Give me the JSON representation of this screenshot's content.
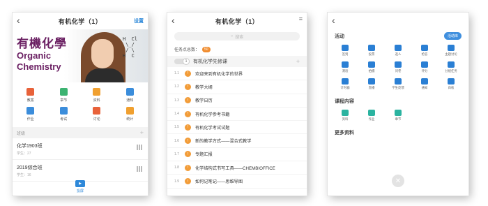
{
  "phone1": {
    "title": "有机化学（1）",
    "settings": "设置",
    "banner": {
      "cn": "有機化學",
      "en1": "Organic",
      "en2": "Chemistry"
    },
    "grid": [
      {
        "label": "教案",
        "icon": "lesson-plan-icon",
        "color": "#e8623a"
      },
      {
        "label": "章节",
        "icon": "chapter-icon",
        "color": "#3cb371"
      },
      {
        "label": "资料",
        "icon": "folder-icon",
        "color": "#f0a030"
      },
      {
        "label": "通知",
        "icon": "megaphone-icon",
        "color": "#3b8ddb"
      },
      {
        "label": "作业",
        "icon": "homework-icon",
        "color": "#3b8ddb"
      },
      {
        "label": "考试",
        "icon": "exam-icon",
        "color": "#3b8ddb"
      },
      {
        "label": "讨论",
        "icon": "discussion-icon",
        "color": "#e8623a"
      },
      {
        "label": "统计",
        "icon": "pie-chart-icon",
        "color": "#f0a030"
      }
    ],
    "classes_label": "班级",
    "classes": [
      {
        "name": "化学1903班",
        "students": "学生：27"
      },
      {
        "name": "2019综合班",
        "students": "学生：16"
      }
    ],
    "bottom_label": "投屏"
  },
  "phone2": {
    "title": "有机化学（1）",
    "search_placeholder": "搜索",
    "task_points_label": "任务点总数：",
    "task_points_value": "50",
    "chapter": {
      "num": "1",
      "title": "有机化学先修课"
    },
    "lessons": [
      {
        "num": "1.1",
        "title": "欢迎来到有机化学的世界"
      },
      {
        "num": "1.2",
        "title": "教学大纲"
      },
      {
        "num": "1.3",
        "title": "教学日历"
      },
      {
        "num": "1.4",
        "title": "有机化学参考书籍"
      },
      {
        "num": "1.5",
        "title": "有机化学考试试题"
      },
      {
        "num": "1.6",
        "title": "新的教学方式——混合式教学"
      },
      {
        "num": "1.7",
        "title": "专题汇报"
      },
      {
        "num": "1.8",
        "title": "化学结构式书写工具——CHEMBIOFFICE"
      },
      {
        "num": "1.9",
        "title": "如何记笔记——思维导图"
      }
    ]
  },
  "phone3": {
    "activities_label": "活动",
    "activity_library": "活动库",
    "activities": [
      {
        "label": "签到",
        "icon": "checkin-icon"
      },
      {
        "label": "投票",
        "icon": "vote-icon"
      },
      {
        "label": "选人",
        "icon": "pick-person-icon"
      },
      {
        "label": "抢答",
        "icon": "quick-answer-icon"
      },
      {
        "label": "主题讨论",
        "icon": "topic-discussion-icon"
      },
      {
        "label": "测验",
        "icon": "quiz-icon"
      },
      {
        "label": "拍摄",
        "icon": "camera-icon"
      },
      {
        "label": "问卷",
        "icon": "questionnaire-icon"
      },
      {
        "label": "评分",
        "icon": "rating-icon"
      },
      {
        "label": "分组任务",
        "icon": "group-task-icon"
      },
      {
        "label": "计时器",
        "icon": "timer-icon"
      },
      {
        "label": "直播",
        "icon": "live-icon"
      },
      {
        "label": "学生反馈",
        "icon": "feedback-icon"
      },
      {
        "label": "通知",
        "icon": "notice-icon"
      },
      {
        "label": "白板",
        "icon": "whiteboard-icon"
      }
    ],
    "course_content_label": "课程内容",
    "course_content": [
      {
        "label": "资料",
        "icon": "materials-icon"
      },
      {
        "label": "作业",
        "icon": "homework-icon"
      },
      {
        "label": "章节",
        "icon": "chapter-icon"
      }
    ],
    "more_materials_label": "更多资料"
  }
}
